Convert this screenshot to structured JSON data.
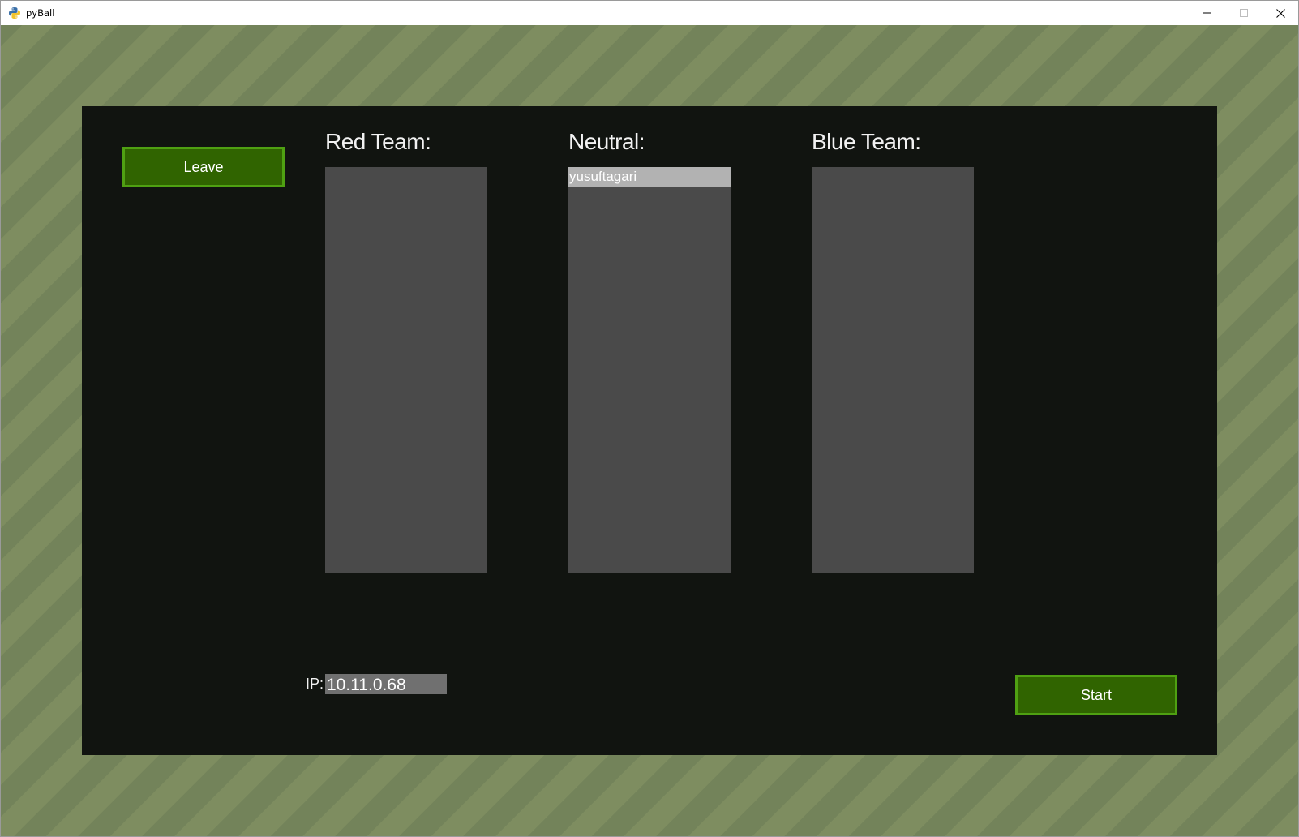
{
  "window": {
    "title": "pyBall",
    "icon": "python-icon"
  },
  "lobby": {
    "leave_label": "Leave",
    "start_label": "Start",
    "teams": [
      {
        "title": "Red Team:",
        "players": []
      },
      {
        "title": "Neutral:",
        "players": [
          "yusuftagari"
        ]
      },
      {
        "title": "Blue Team:",
        "players": []
      }
    ],
    "ip_label": "IP:",
    "ip_value": "10.11.0.68"
  },
  "colors": {
    "button_fill": "#306400",
    "button_border": "#4fa012",
    "panel": "#111410",
    "list_bg": "#4a4a4a",
    "selected_player_bg": "#b2b2b2",
    "ip_field_bg": "#707070",
    "background_stripe_light": "#7e8d60",
    "background_stripe_dark": "#73835a"
  }
}
